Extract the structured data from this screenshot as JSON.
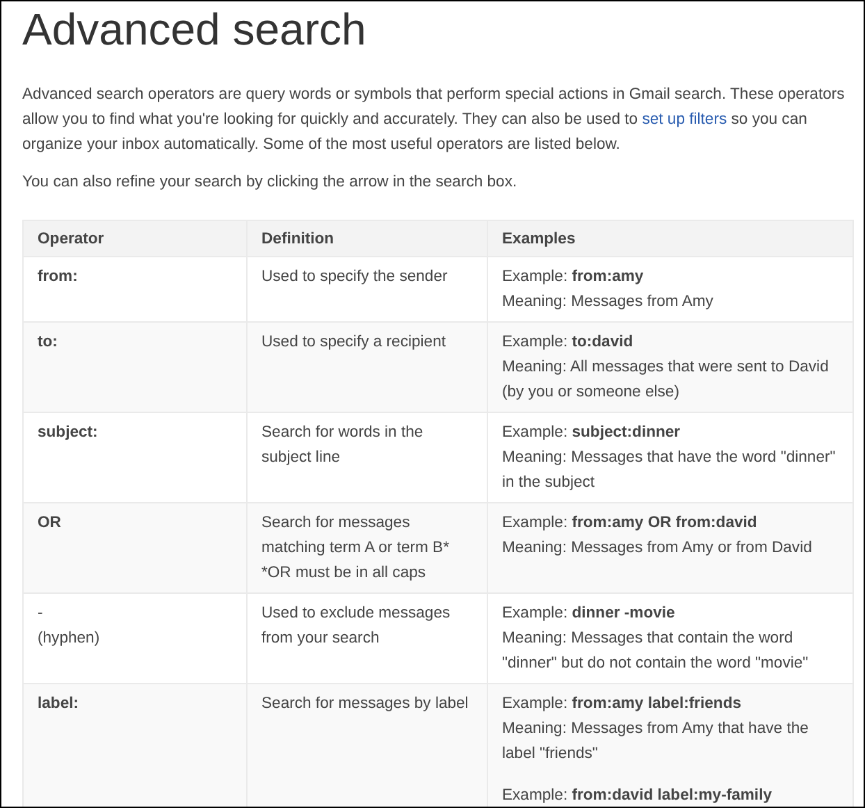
{
  "title": "Advanced search",
  "paragraphs": [
    {
      "parts": [
        {
          "kind": "text",
          "text": "Advanced search operators are query words or symbols that perform special actions in Gmail search. These operators allow you to find what you're looking for quickly and accurately. They can also be used to "
        },
        {
          "kind": "link",
          "text": "set up filters"
        },
        {
          "kind": "text",
          "text": " so you can organize your inbox automatically. Some of the most useful operators are listed below."
        }
      ]
    },
    {
      "parts": [
        {
          "kind": "text",
          "text": "You can also refine your search by clicking the arrow in the search box."
        }
      ]
    }
  ],
  "table": {
    "columns": [
      "Operator",
      "Definition",
      "Examples"
    ],
    "rows": [
      {
        "operator": [
          "from:"
        ],
        "operator_bold": true,
        "definition": [
          "Used to specify the sender"
        ],
        "examples": [
          {
            "example": "Example: **from:amy**",
            "meaning": "Meaning: Messages from Amy"
          }
        ]
      },
      {
        "operator": [
          "to:"
        ],
        "operator_bold": true,
        "definition": [
          "Used to specify a recipient"
        ],
        "examples": [
          {
            "example": "Example: **to:david**",
            "meaning": "Meaning: All messages that were sent to David (by you or someone else)"
          }
        ]
      },
      {
        "operator": [
          "subject:"
        ],
        "operator_bold": true,
        "definition": [
          "Search for words in the subject line"
        ],
        "examples": [
          {
            "example": "Example: **subject:dinner**",
            "meaning": "Meaning: Messages that have the word \"dinner\" in the subject"
          }
        ]
      },
      {
        "operator": [
          "OR"
        ],
        "operator_bold": true,
        "definition": [
          "Search for messages matching term A or term B*",
          "*OR must be in all caps"
        ],
        "examples": [
          {
            "example": "Example: **from:amy OR from:david**",
            "meaning": "Meaning: Messages from Amy or from David"
          }
        ]
      },
      {
        "operator": [
          "-",
          "(hyphen)"
        ],
        "operator_bold": false,
        "definition": [
          "Used to exclude messages from your search"
        ],
        "examples": [
          {
            "example": "Example: **dinner -movie**",
            "meaning": "Meaning: Messages that contain the word \"dinner\" but do not contain the word \"movie\""
          }
        ]
      },
      {
        "operator": [
          "label:"
        ],
        "operator_bold": true,
        "definition": [
          "Search for messages by label"
        ],
        "examples": [
          {
            "example": "Example: **from:amy label:friends**",
            "meaning": "Meaning: Messages from Amy that have the label \"friends\""
          },
          {
            "example": "Example: **from:david label:my-family**"
          }
        ]
      }
    ]
  }
}
